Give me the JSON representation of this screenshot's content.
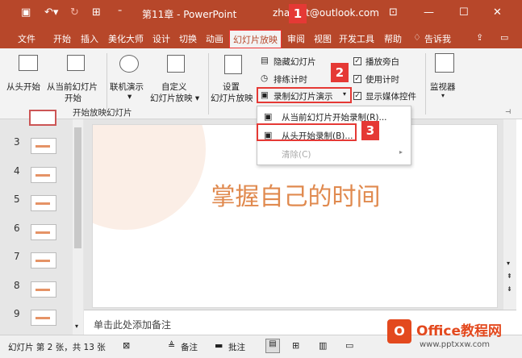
{
  "titlebar": {
    "title": "第11章 - PowerPoint",
    "account": "zhangtt@outlook.com",
    "badge": "1"
  },
  "tabs": [
    "文件",
    "开始",
    "插入",
    "美化大师",
    "设计",
    "切换",
    "动画",
    "幻灯片放映",
    "审阅",
    "视图",
    "开发工具",
    "帮助",
    "告诉我"
  ],
  "ribbon": {
    "from_start": "从头开始",
    "from_current_l1": "从当前幻灯片",
    "from_current_l2": "开始",
    "online_l1": "联机演示",
    "online_l2": "▾",
    "custom_l1": "自定义",
    "custom_l2": "幻灯片放映 ▾",
    "group1": "开始放映幻灯片",
    "setup_l1": "设置",
    "setup_l2": "幻灯片放映",
    "hide": "隐藏幻灯片",
    "rehearse": "排练计时",
    "record": "录制幻灯片演示",
    "play_narrations": "播放旁白",
    "use_timings": "使用计时",
    "show_media": "显示媒体控件",
    "monitor": "监视器",
    "badge2": "2"
  },
  "dropdown": {
    "item1": "从当前幻灯片开始录制(R)...",
    "item2": "从头开始录制(B)...",
    "item3": "清除(C)",
    "badge3": "3"
  },
  "slides": [
    "3",
    "4",
    "5",
    "6",
    "7",
    "8",
    "9"
  ],
  "slide_title": "掌握自己的时间",
  "notes_placeholder": "单击此处添加备注",
  "status": {
    "slide_info": "幻灯片 第 2 张，共 13 张",
    "notes": "备注",
    "comments": "批注"
  },
  "watermark": {
    "brand": "Office教程网",
    "url": "www.pptxxw.com"
  },
  "colors": {
    "accent": "#b7472a",
    "title_color": "#e08a4f",
    "marker": "#e53935"
  }
}
